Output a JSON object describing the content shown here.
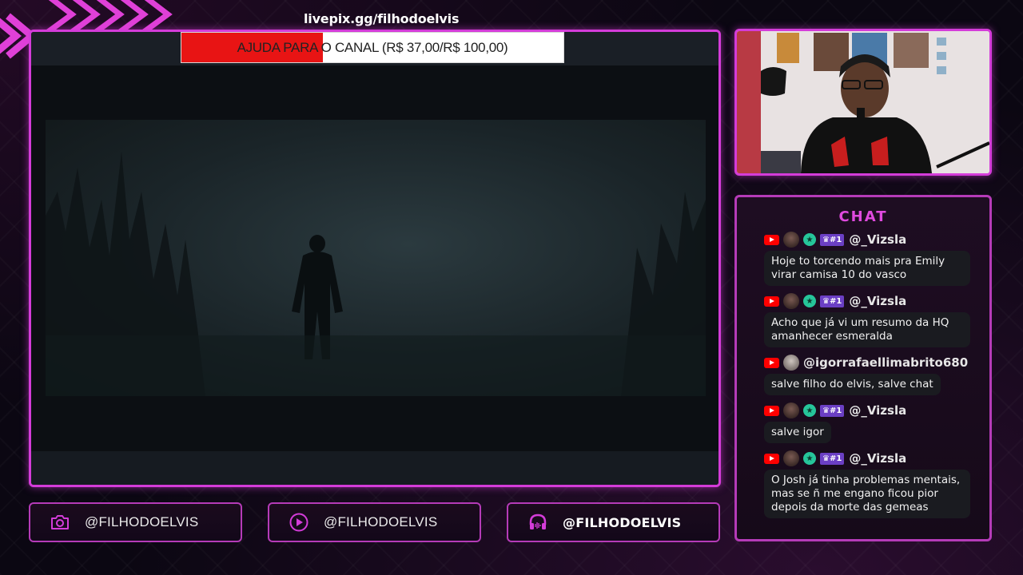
{
  "overlay": {
    "livepix_url": "livepix.gg/filhodoelvis",
    "goal": {
      "text": "AJUDA PARA O CANAL (R$ 37,00/R$ 100,00)",
      "current": 37,
      "target": 100,
      "fill_color": "#e81414"
    },
    "accent_color": "#d43cd9"
  },
  "chat": {
    "title": "CHAT",
    "messages": [
      {
        "platform": "youtube",
        "user": "@_Vizsla",
        "badges": [
          "member-star",
          "crown-1"
        ],
        "text": "Hoje to torcendo mais pra Emily virar camisa 10 do vasco"
      },
      {
        "platform": "youtube",
        "user": "@_Vizsla",
        "badges": [
          "member-star",
          "crown-1"
        ],
        "text": "Acho que já vi um resumo da HQ amanhecer esmeralda"
      },
      {
        "platform": "youtube",
        "user": "@igorrafaellimabrito680",
        "badges": [],
        "text": "salve filho do elvis, salve chat"
      },
      {
        "platform": "youtube",
        "user": "@_Vizsla",
        "badges": [
          "member-star",
          "crown-1"
        ],
        "text": "salve igor"
      },
      {
        "platform": "youtube",
        "user": "@_Vizsla",
        "badges": [
          "member-star",
          "crown-1"
        ],
        "text": "O Josh já tinha problemas mentais, mas se ñ me engano ficou pior depois da morte das gemeas"
      }
    ],
    "crown_badge_text": "#1"
  },
  "socials": [
    {
      "icon": "camera-icon",
      "label": "@FILHODOELVIS"
    },
    {
      "icon": "play-icon",
      "label": "@FILHODOELVIS"
    },
    {
      "icon": "headphones-icon",
      "label": "@FILHODOELVIS"
    }
  ]
}
